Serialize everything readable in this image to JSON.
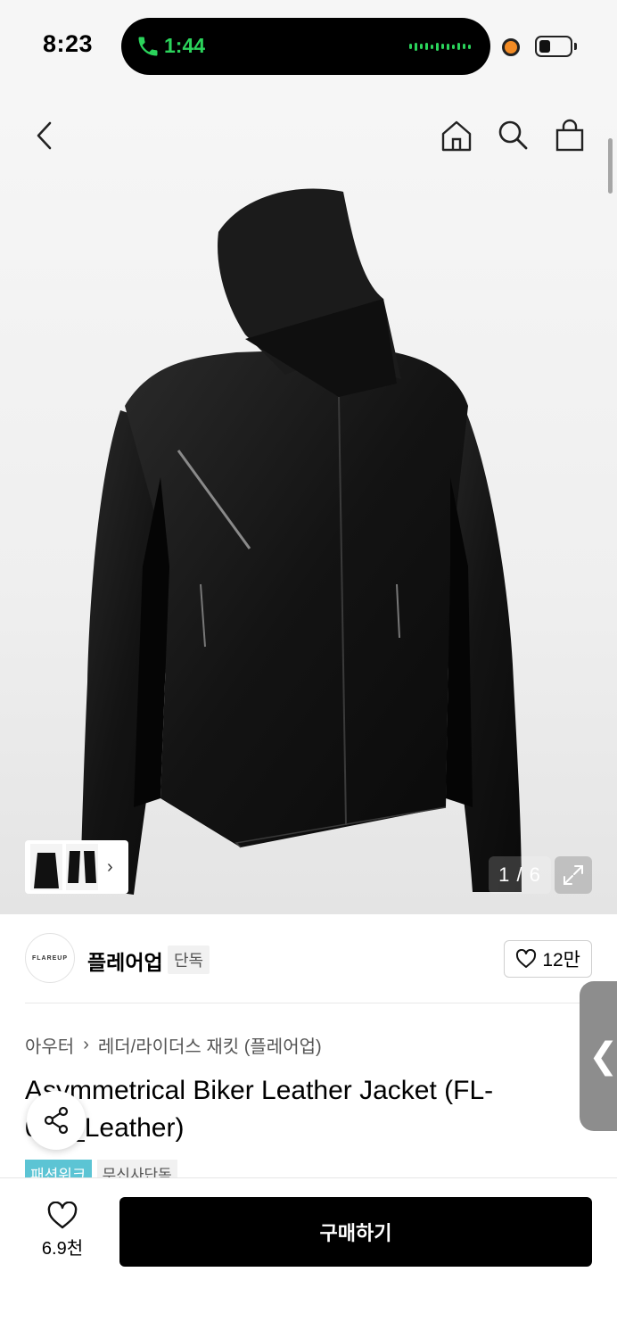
{
  "status_bar": {
    "time": "8:23",
    "call_time": "1:44"
  },
  "gallery": {
    "counter": "1 / 6",
    "thumb_arrow": "›"
  },
  "brand": {
    "logo_text": "FLAREUP",
    "name": "플레어업",
    "tag": "단독",
    "likes": "12만"
  },
  "breadcrumb": {
    "level1": "아우터",
    "separator": "›",
    "level2": "레더/라이더스 재킷 (플레어업)"
  },
  "product": {
    "title": "Asymmetrical Biker Leather Jacket (FL-047_Leather)"
  },
  "tags": {
    "fashion_week": "패션위크",
    "musinsa_exclusive": "무신사단독"
  },
  "side_tab": {
    "label": "❮"
  },
  "bottom": {
    "wish_count": "6.9천",
    "buy_label": "구매하기"
  },
  "colors": {
    "accent_green": "#2bd35b",
    "tag_teal": "#5cc4d4",
    "buy_button": "#000000"
  }
}
